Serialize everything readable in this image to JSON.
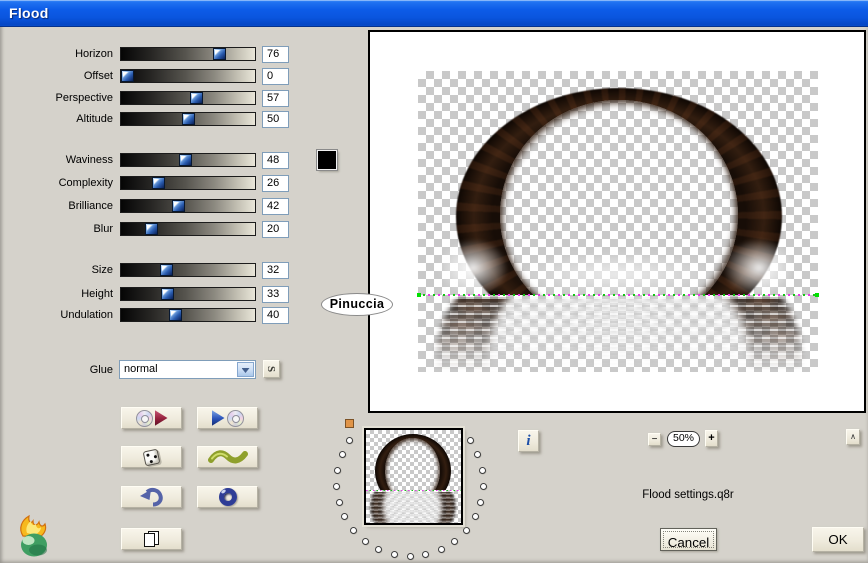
{
  "window": {
    "title": "Flood"
  },
  "sliders": [
    {
      "label": "Horizon",
      "value": 76
    },
    {
      "label": "Offset",
      "value": 0
    },
    {
      "label": "Perspective",
      "value": 57
    },
    {
      "label": "Altitude",
      "value": 50
    },
    {
      "label": "Waviness",
      "value": 48
    },
    {
      "label": "Complexity",
      "value": 26
    },
    {
      "label": "Brilliance",
      "value": 42
    },
    {
      "label": "Blur",
      "value": 20
    },
    {
      "label": "Size",
      "value": 32
    },
    {
      "label": "Height",
      "value": 33
    },
    {
      "label": "Undulation",
      "value": 40
    }
  ],
  "glue": {
    "label": "Glue",
    "selected": "normal",
    "swap_button": "S"
  },
  "color_well": {
    "color": "#000000"
  },
  "tool_buttons": [
    {
      "name": "load-settings-button",
      "icons": [
        "cd-icon",
        "play-red-icon"
      ]
    },
    {
      "name": "save-settings-button",
      "icons": [
        "play-blue-icon",
        "cd-icon"
      ]
    },
    {
      "name": "randomize-button",
      "icons": [
        "dice-icon"
      ]
    },
    {
      "name": "wave-button",
      "icons": [
        "wave-icon"
      ]
    },
    {
      "name": "undo-button",
      "icons": [
        "undo-arrow-icon"
      ]
    },
    {
      "name": "ring-button",
      "icons": [
        "ring-icon"
      ]
    },
    {
      "name": "copy-button",
      "icons": [
        "pages-icon"
      ]
    }
  ],
  "preview": {
    "watermark": "Pinuccia",
    "zoom_out": "−",
    "zoom_level": "50%",
    "zoom_in": "+",
    "collapse": "∧",
    "info": "i",
    "filename": "Flood settings.q8r"
  },
  "actions": {
    "cancel": "Cancel",
    "ok": "OK"
  },
  "colors": {
    "titlebar_top": "#3a8bf8",
    "titlebar_bottom": "#0446c6",
    "dialog_bg": "#d5d2cb",
    "value_border": "#7f9db9",
    "slider_thumb": "#2a5cb0",
    "swatch": "#000000",
    "horizon_green": "#17c417",
    "horizon_magenta": "#e837e8"
  }
}
